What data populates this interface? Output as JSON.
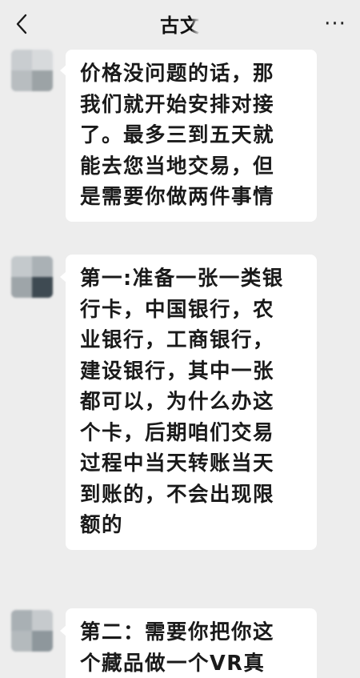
{
  "header": {
    "title": "古文",
    "back_icon": "chevron-left-icon",
    "more_icon": "more-dots-icon",
    "more_glyph": "···"
  },
  "messages": [
    {
      "sender": "contact",
      "lines": [
        "价格没问题的话，那",
        "我们就开始安排对接",
        "了。最多三到五天就",
        "能去您当地交易，但",
        "是需要你做两件事情"
      ]
    },
    {
      "sender": "contact",
      "lines": [
        "第一:准备一张一类银",
        "行卡，中国银行，农",
        "业银行，工商银行，",
        "建设银行，其中一张",
        "都可以，为什么办这",
        "个卡，后期咱们交易",
        "过程中当天转账当天",
        "到账的，不会出现限",
        "额的"
      ]
    },
    {
      "sender": "contact",
      "lines": [
        "第二：需要你把你这",
        "个藏品做一个VR真"
      ]
    }
  ]
}
